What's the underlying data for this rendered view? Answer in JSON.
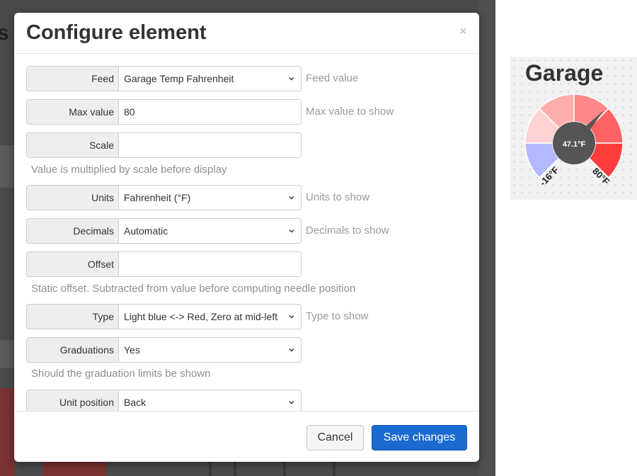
{
  "dialog": {
    "title": "Configure element",
    "close_glyph": "×",
    "fields": [
      {
        "label": "Feed",
        "value": "Garage Temp Fahrenheit",
        "hint": "Feed value"
      },
      {
        "label": "Max value",
        "value": "80",
        "hint": "Max value to show"
      },
      {
        "label": "Scale",
        "value": "",
        "help": "Value is multiplied by scale before display"
      },
      {
        "label": "Units",
        "value": "Fahrenheit (°F)",
        "hint": "Units to show"
      },
      {
        "label": "Decimals",
        "value": "Automatic",
        "hint": "Decimals to show"
      },
      {
        "label": "Offset",
        "value": "",
        "help": "Static offset. Subtracted from value before computing needle position"
      },
      {
        "label": "Type",
        "value": "Light blue <-> Red, Zero at mid-left",
        "hint": "Type to show"
      },
      {
        "label": "Graduations",
        "value": "Yes",
        "help": "Should the graduation limits be shown"
      },
      {
        "label": "Unit position",
        "value": "Back"
      }
    ],
    "cancel_label": "Cancel",
    "save_label": "Save changes",
    "save_color": "#1a6ad0"
  },
  "preview": {
    "title": "Garage",
    "current_value": "47.1°F",
    "min_label": "-16°F",
    "max_label": "80°F",
    "min": -16,
    "max": 80,
    "value": 47.1,
    "colors": {
      "cold": "#b4b8ff",
      "warm": "#ff2a2a",
      "hub": "#555555"
    }
  }
}
